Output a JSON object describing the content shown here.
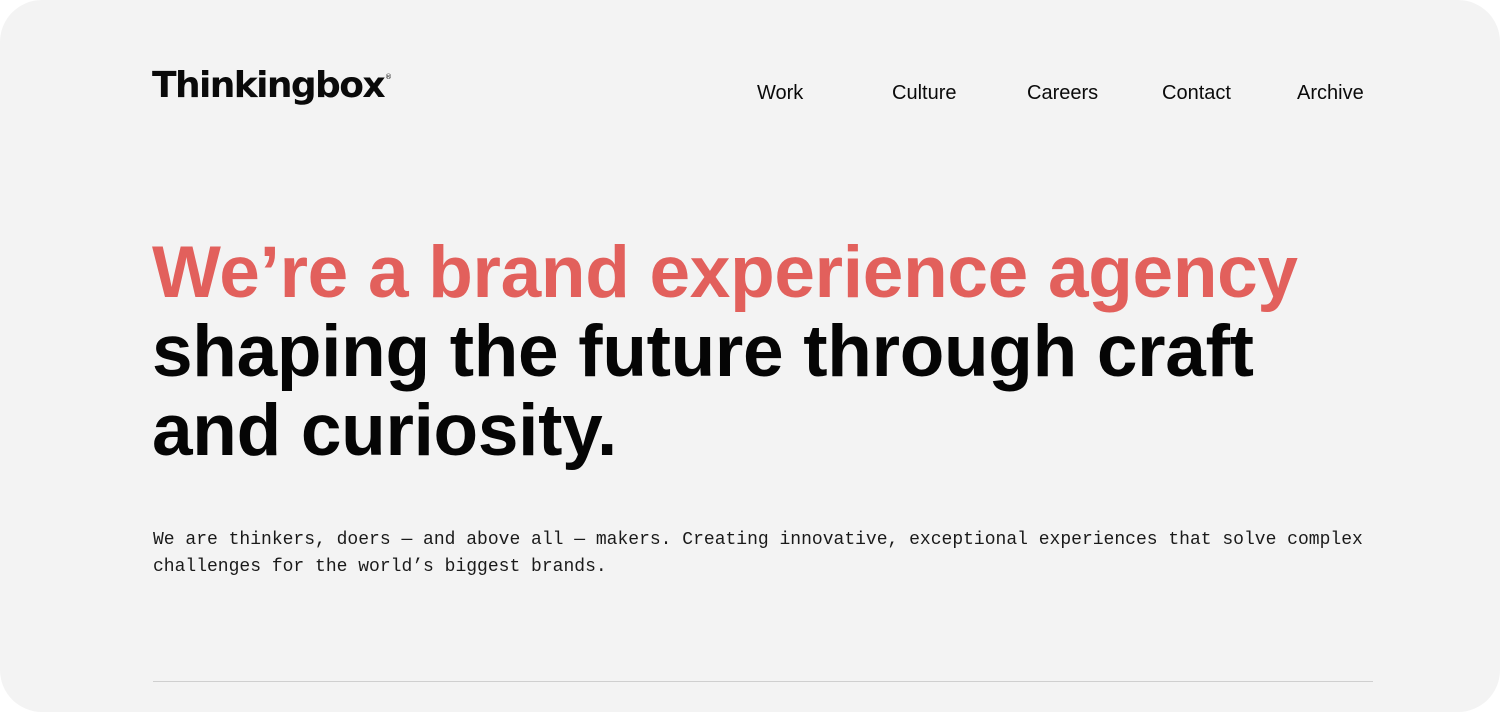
{
  "brand": {
    "logo_text": "Thinkingbox",
    "logo_mark": "®"
  },
  "nav": {
    "items": [
      {
        "label": "Work"
      },
      {
        "label": "Culture"
      },
      {
        "label": "Careers"
      },
      {
        "label": "Contact"
      },
      {
        "label": "Archive"
      }
    ]
  },
  "hero": {
    "headline_accent": "We’re a brand experience agency",
    "headline_line2": "shaping the future through craft",
    "headline_line3": "and curiosity.",
    "intro_line1": "We are thinkers, doers — and above all — makers. Creating innovative, exceptional experiences that solve complex",
    "intro_line2": "challenges for the world’s biggest brands."
  },
  "colors": {
    "background": "#f3f3f3",
    "accent": "#e2605c",
    "text": "#0a0a0a",
    "divider": "#cfcfcf"
  }
}
